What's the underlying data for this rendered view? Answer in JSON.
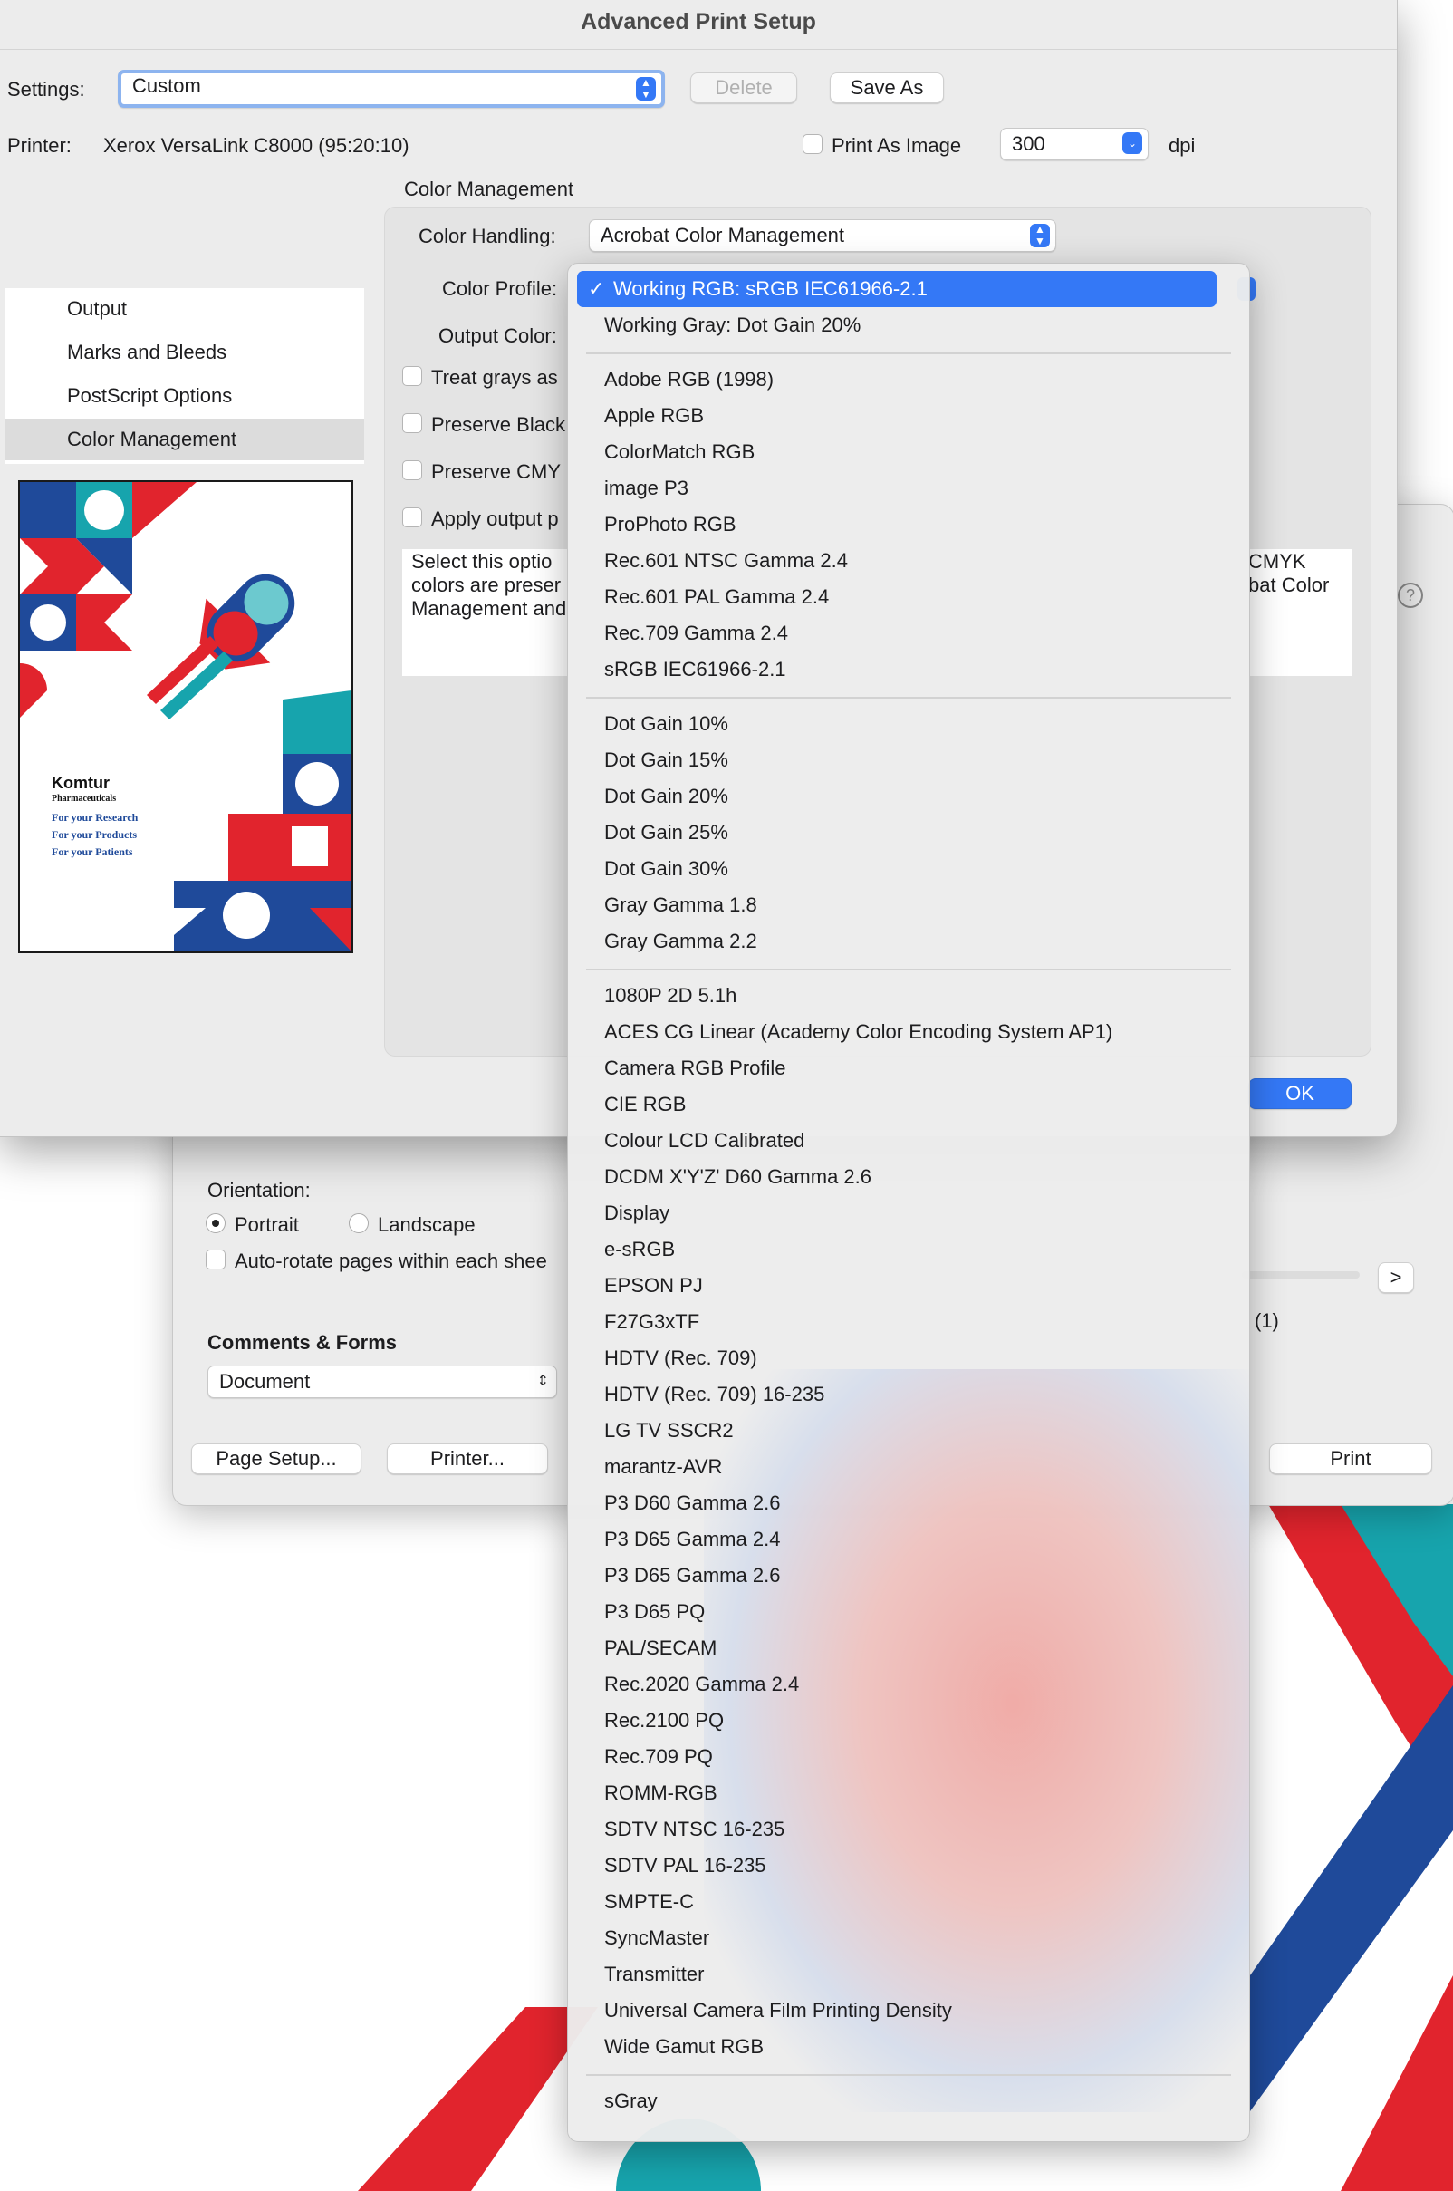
{
  "setup_dialog": {
    "title": "Advanced Print Setup",
    "settings_label": "Settings:",
    "settings_value": "Custom",
    "delete_label": "Delete",
    "save_as_label": "Save As",
    "printer_label": "Printer:",
    "printer_name": "Xerox VersaLink C8000 (95:20:10)",
    "print_as_image_label": "Print As Image",
    "print_as_image_checked": false,
    "dpi_value": "300",
    "dpi_unit": "dpi",
    "section_heading": "Color Management",
    "sidebar_items": [
      "Output",
      "Marks and Bleeds",
      "PostScript Options",
      "Color Management"
    ],
    "selected_sidebar_item": "Color Management",
    "color_handling_label": "Color Handling:",
    "color_handling_value": "Acrobat Color Management",
    "color_profile_label": "Color Profile:",
    "output_color_label": "Output Color:",
    "checkboxes": [
      "Treat grays as",
      "Preserve Black",
      "Preserve CMY",
      "Apply output p"
    ],
    "description_lines_left": [
      "Select this optio",
      "colors are preser",
      "Management and"
    ],
    "description_lines_right": [
      "CMYK",
      "bat Color"
    ],
    "ok_label": "OK",
    "preview_brand": "Komtur",
    "preview_brand_sub": "Pharmaceuticals",
    "preview_taglines": [
      "For your Research",
      "For your Products",
      "For your Patients"
    ]
  },
  "print_dialog": {
    "orientation_label": "Orientation:",
    "portrait_label": "Portrait",
    "landscape_label": "Landscape",
    "autorotate_label": "Auto-rotate pages within each shee",
    "page_nav_next": ">",
    "page_count": "(1)",
    "comments_heading": "Comments & Forms",
    "comments_value": "Document",
    "page_setup_label": "Page Setup...",
    "printer_button_label": "Printer...",
    "print_label": "Print",
    "help_icon_glyph": "?"
  },
  "color_profile_menu": {
    "selected": "Working RGB: sRGB IEC61966-2.1",
    "check_glyph": "✓",
    "groups": [
      [
        "Working RGB: sRGB IEC61966-2.1",
        "Working Gray: Dot Gain 20%"
      ],
      [
        "Adobe RGB (1998)",
        "Apple RGB",
        "ColorMatch RGB",
        "image P3",
        "ProPhoto RGB",
        "Rec.601 NTSC Gamma 2.4",
        "Rec.601 PAL Gamma 2.4",
        "Rec.709 Gamma 2.4",
        "sRGB IEC61966-2.1"
      ],
      [
        "Dot Gain 10%",
        "Dot Gain 15%",
        "Dot Gain 20%",
        "Dot Gain 25%",
        "Dot Gain 30%",
        "Gray Gamma 1.8",
        "Gray Gamma 2.2"
      ],
      [
        "1080P 2D 5.1h",
        "ACES CG Linear (Academy Color Encoding System AP1)",
        "Camera RGB Profile",
        "CIE RGB",
        "Colour LCD Calibrated",
        "DCDM X'Y'Z' D60 Gamma 2.6",
        "Display",
        "e-sRGB",
        "EPSON PJ",
        "F27G3xTF",
        "HDTV (Rec. 709)",
        "HDTV (Rec. 709) 16-235",
        "LG TV SSCR2",
        "marantz-AVR",
        "P3 D60 Gamma 2.6",
        "P3 D65 Gamma 2.4",
        "P3 D65 Gamma 2.6",
        "P3 D65 PQ",
        "PAL/SECAM",
        "Rec.2020 Gamma 2.4",
        "Rec.2100 PQ",
        "Rec.709 PQ",
        "ROMM-RGB",
        "SDTV NTSC 16-235",
        "SDTV PAL 16-235",
        "SMPTE-C",
        "SyncMaster",
        "Transmitter",
        "Universal Camera Film Printing Density",
        "Wide Gamut RGB"
      ],
      [
        "sGray"
      ]
    ]
  },
  "colors": {
    "accent": "#3478f6",
    "brand_red": "#e1242d",
    "brand_blue": "#1f4a9a",
    "brand_teal": "#17a4ad"
  }
}
